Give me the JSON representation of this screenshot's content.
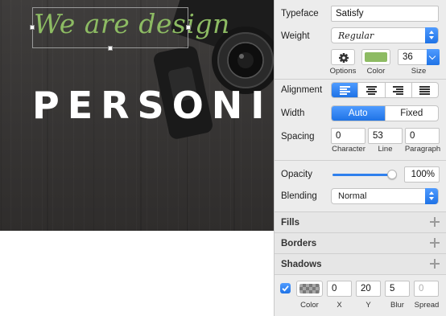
{
  "canvas": {
    "script_text": "We are design",
    "headline": "PERSONIF"
  },
  "inspector": {
    "typeface": {
      "label": "Typeface",
      "value": "Satisfy"
    },
    "weight": {
      "label": "Weight",
      "value": "Regular"
    },
    "options_label": "Options",
    "color_label": "Color",
    "text_color": "#8dbb63",
    "size": {
      "label": "Size",
      "value": "36"
    },
    "alignment": {
      "label": "Alignment",
      "selected": "left",
      "options": [
        "left",
        "center",
        "right",
        "justify"
      ]
    },
    "width": {
      "label": "Width",
      "options": [
        "Auto",
        "Fixed"
      ],
      "selected": "Auto"
    },
    "spacing": {
      "label": "Spacing",
      "character": {
        "label": "Character",
        "value": "0"
      },
      "line": {
        "label": "Line",
        "value": "53"
      },
      "paragraph": {
        "label": "Paragraph",
        "value": "0"
      }
    },
    "opacity": {
      "label": "Opacity",
      "value": "100%",
      "fraction": 1.0
    },
    "blending": {
      "label": "Blending",
      "value": "Normal"
    },
    "sections": {
      "fills": "Fills",
      "borders": "Borders",
      "shadows": "Shadows"
    },
    "shadow": {
      "enabled": true,
      "color_label": "Color",
      "x": {
        "label": "X",
        "value": "0"
      },
      "y": {
        "label": "Y",
        "value": "20"
      },
      "blur": {
        "label": "Blur",
        "value": "5"
      },
      "spread": {
        "label": "Spread",
        "value": "0"
      }
    },
    "accent_color": "#2f80ed"
  }
}
